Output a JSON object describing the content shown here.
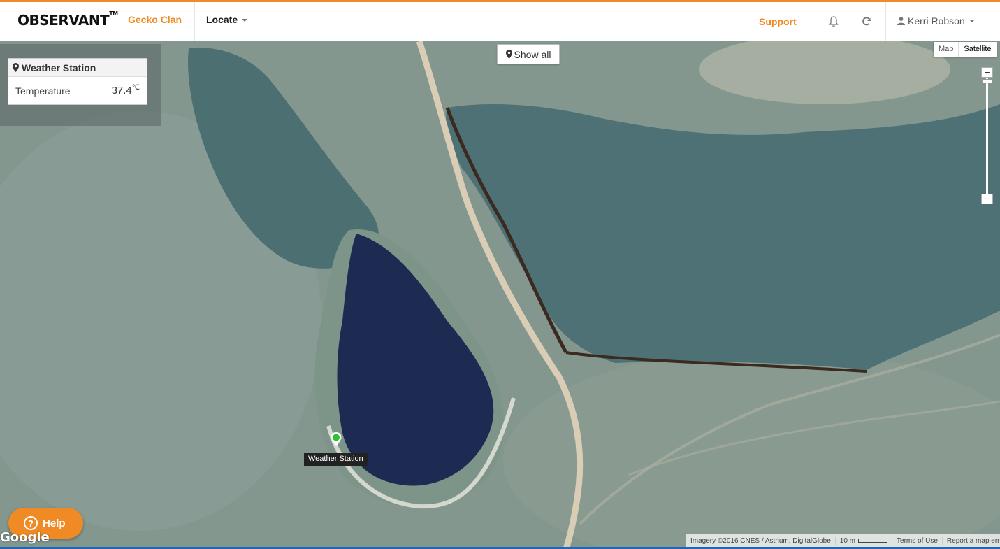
{
  "navbar": {
    "brand": "OBSERVANT",
    "brand_mark": "TM",
    "org": "Gecko Clan",
    "locate": "Locate",
    "support": "Support",
    "user": "Kerri Robson",
    "icons": [
      "bell-icon",
      "refresh-icon",
      "user-icon",
      "caret-down-icon"
    ]
  },
  "station_panel": {
    "title": "Weather Station",
    "row_label": "Temperature",
    "row_value": "37.4",
    "row_unit": "℃"
  },
  "map": {
    "show_all": "Show all",
    "type_map": "Map",
    "type_satellite": "Satellite",
    "active_type": "Satellite",
    "zoom_in": "+",
    "zoom_out": "−",
    "marker_label": "Weather Station",
    "marker_color": "#2ec22e",
    "logo": "Google",
    "attribution": "Imagery ©2016 CNES / Astrium, DigitalGlobe",
    "scale": "10 m",
    "terms": "Terms of Use",
    "report": "Report a map error"
  },
  "help": {
    "label": "Help",
    "icon": "question-icon"
  },
  "colors": {
    "accent": "#f08a24",
    "grass": "#7f948c",
    "trees": "#4f7478",
    "water": "#1d2a52",
    "road": "#d9cdb6"
  }
}
